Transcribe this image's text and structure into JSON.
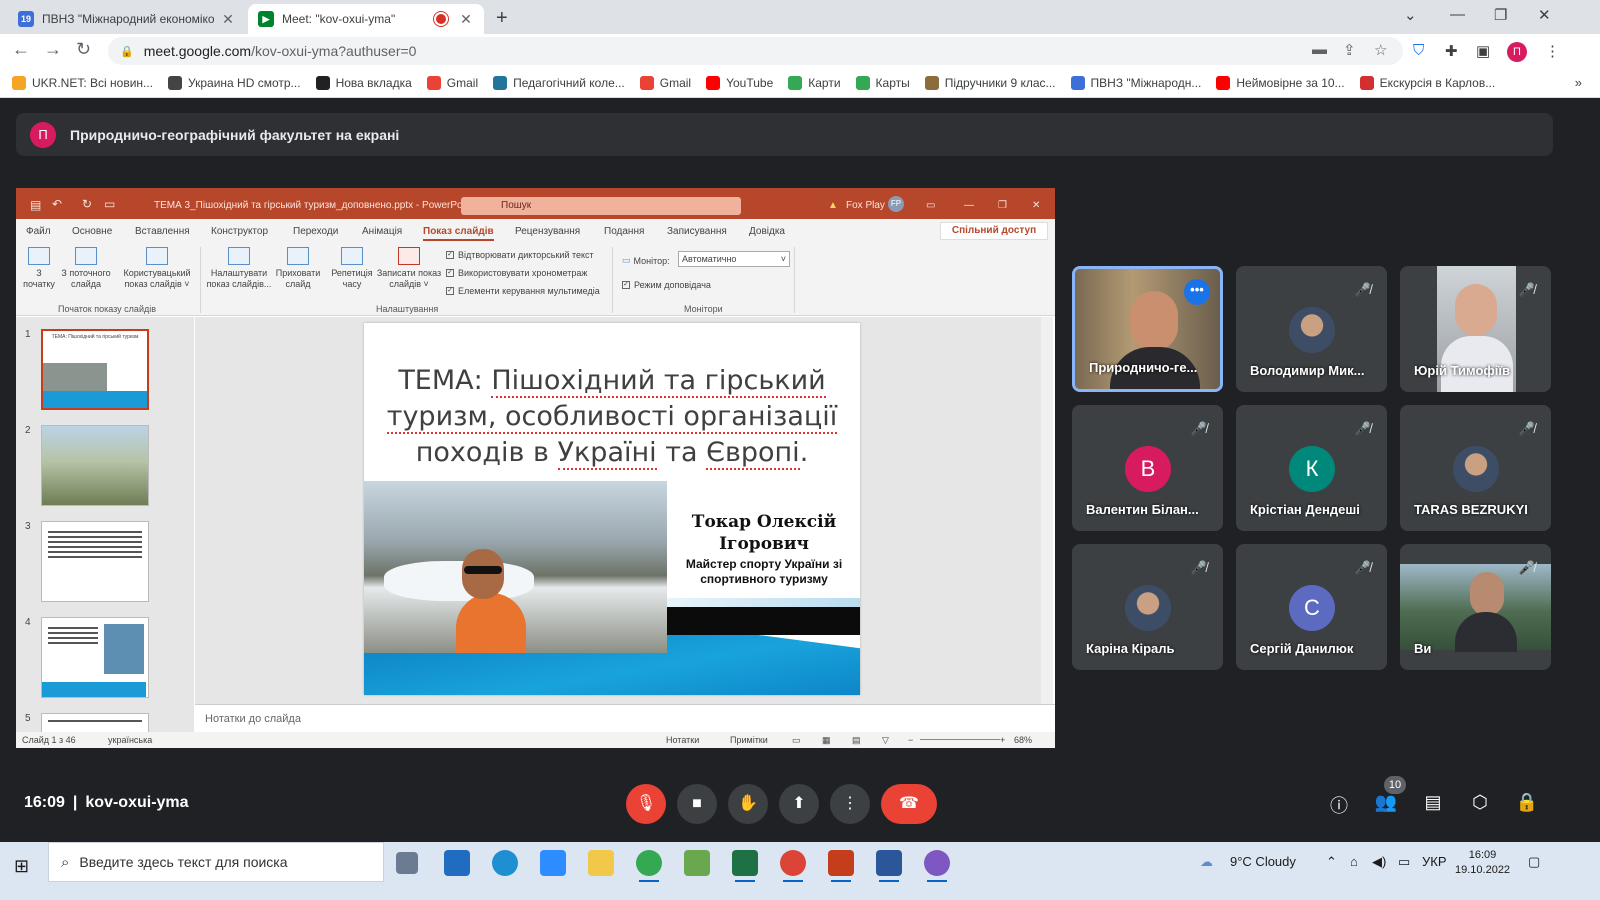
{
  "browser": {
    "tabs": [
      {
        "title": "ПВНЗ \"Міжнародний економіко",
        "favicon_color": "#3d6fd8",
        "favicon_text": "19"
      },
      {
        "title": "Meet: \"kov-oxui-yma\"",
        "favicon_color": "#00832d",
        "favicon_text": ""
      }
    ],
    "url_host": "meet.google.com",
    "url_path": "/kov-oxui-yma?authuser=0",
    "profile_letter": "П",
    "bookmarks": [
      {
        "label": "UKR.NET: Всі новин...",
        "color": "#f4a623"
      },
      {
        "label": "Украина HD смотр...",
        "color": "#444444"
      },
      {
        "label": "Нова вкладка",
        "color": "#202124"
      },
      {
        "label": "Gmail",
        "color": "#ea4335"
      },
      {
        "label": "Педагогічний коле...",
        "color": "#21759b"
      },
      {
        "label": "Gmail",
        "color": "#ea4335"
      },
      {
        "label": "YouTube",
        "color": "#ff0000"
      },
      {
        "label": "Карти",
        "color": "#34a853"
      },
      {
        "label": "Карты",
        "color": "#34a853"
      },
      {
        "label": "Підручники 9 клас...",
        "color": "#8a6d3b"
      },
      {
        "label": "ПВНЗ \"Міжнародн...",
        "color": "#3d6fd8"
      },
      {
        "label": "Неймовірне за 10...",
        "color": "#ff0000"
      },
      {
        "label": "Екскурсія в Карлов...",
        "color": "#d32f2f"
      }
    ]
  },
  "meet": {
    "banner_avatar": "П",
    "banner_text": "Природничо-географічний факультет на екрані",
    "time": "16:09",
    "meeting_code": "kov-oxui-yma",
    "participants_count": "10",
    "participants": [
      {
        "name": "Природничо-ге...",
        "kind": "video-speaker"
      },
      {
        "name": "Володимир Мик...",
        "kind": "photo"
      },
      {
        "name": "Юрій Тимофіїв",
        "kind": "video-yuriy"
      },
      {
        "name": "Валентин Білан...",
        "kind": "letter",
        "letter": "В",
        "color": "#d81b60"
      },
      {
        "name": "Крістіан Дендеші",
        "kind": "letter",
        "letter": "К",
        "color": "#00897b"
      },
      {
        "name": "TARAS BEZRUKYI",
        "kind": "photo"
      },
      {
        "name": "Каріна Кіраль",
        "kind": "photo"
      },
      {
        "name": "Сергій Данилюк",
        "kind": "letter",
        "letter": "С",
        "color": "#5c6bc0"
      },
      {
        "name": "Ви",
        "kind": "video-you"
      }
    ]
  },
  "powerpoint": {
    "title": "ТЕМА 3_Пішохідний та гірський туризм_доповнено.pptx - PowerPoint",
    "search": "Пошук",
    "user": "Fox Play",
    "user_initials": "FP",
    "tabs": [
      "Файл",
      "Основне",
      "Вставлення",
      "Конструктор",
      "Переходи",
      "Анімація",
      "Показ слайдів",
      "Рецензування",
      "Подання",
      "Записування",
      "Довідка"
    ],
    "share": "Спільний доступ",
    "ribbon": {
      "btn_start_1": "З",
      "btn_start_2": "початку",
      "btn_current_1": "З поточного",
      "btn_current_2": "слайда",
      "btn_custom_1": "Користувацький",
      "btn_custom_2": "показ слайдів ˅",
      "btn_setup_1": "Налаштувати",
      "btn_setup_2": "показ слайдів...",
      "btn_hide_1": "Приховати",
      "btn_hide_2": "слайд",
      "btn_rehearse_1": "Репетиція",
      "btn_rehearse_2": "часу",
      "btn_record_1": "Записати показ",
      "btn_record_2": "слайдів ˅",
      "chk_narration": "Відтворювати дикторський текст",
      "chk_timings": "Використовувати хронометраж",
      "chk_media": "Елементи керування мультимедіа",
      "monitor_label": "Монітор:",
      "monitor_value": "Автоматично",
      "presenter_view": "Режим доповідача",
      "group_start": "Початок показу слайдів",
      "group_setup": "Налаштування",
      "group_monitors": "Монітори"
    },
    "slide": {
      "title_prefix": "ТЕМА: ",
      "title_line1_u": "Пішохідний та гірський",
      "title_line2_u": "туризм, особливості організації",
      "title_line3_a": "походів в ",
      "title_line3_u": "Україні",
      "title_line3_b": " та ",
      "title_line3_c": "Європі",
      "title_line3_d": ".",
      "author_line1": "Токар Олексій",
      "author_line2": "Ігорович",
      "subtitle": "Майстер спорту України зі спортивного туризму"
    },
    "thumb_numbers": [
      "1",
      "2",
      "3",
      "4",
      "5"
    ],
    "notes_placeholder": "Нотатки до слайда",
    "status_slide": "Слайд 1 з 46",
    "status_lang": "українська",
    "status_notes": "Нотатки",
    "status_comments": "Примітки",
    "zoom": "68%"
  },
  "taskbar": {
    "search_placeholder": "Введите здесь текст для поиска",
    "weather": "9°C  Cloudy",
    "lang": "УКР",
    "time": "16:09",
    "date": "19.10.2022"
  }
}
